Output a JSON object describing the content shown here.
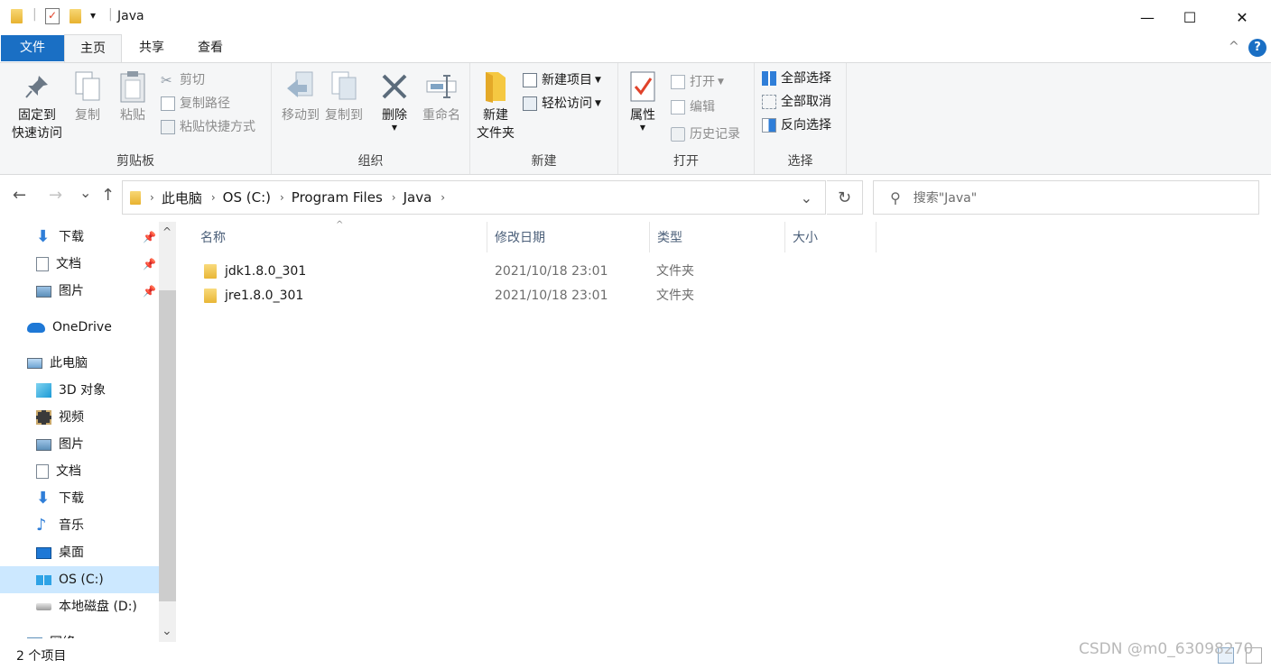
{
  "window": {
    "title": "Java",
    "minimize_glyph": "—",
    "maximize_glyph": "☐",
    "close_glyph": "✕"
  },
  "quick_access": {
    "dropdown_glyph": "▾"
  },
  "tabs": [
    {
      "label": "文件"
    },
    {
      "label": "主页"
    },
    {
      "label": "共享"
    },
    {
      "label": "查看"
    }
  ],
  "ribbon": {
    "collapse_glyph": "^",
    "help_glyph": "?",
    "clipboard": {
      "label": "剪贴板",
      "pin_line1": "固定到",
      "pin_line2": "快速访问",
      "copy": "复制",
      "paste": "粘贴",
      "cut": "剪切",
      "copy_path": "复制路径",
      "paste_shortcut": "粘贴快捷方式"
    },
    "organize": {
      "label": "组织",
      "move_to": "移动到",
      "copy_to": "复制到",
      "delete": "删除",
      "rename": "重命名"
    },
    "new": {
      "label": "新建",
      "new_folder_line1": "新建",
      "new_folder_line2": "文件夹",
      "new_item": "新建项目",
      "easy_access": "轻松访问"
    },
    "open": {
      "label": "打开",
      "properties": "属性",
      "open": "打开",
      "edit": "编辑",
      "history": "历史记录"
    },
    "select": {
      "label": "选择",
      "select_all": "全部选择",
      "select_none": "全部取消",
      "invert": "反向选择"
    }
  },
  "navigation": {
    "back_glyph": "←",
    "forward_glyph": "→",
    "recent_glyph": "⌄",
    "up_glyph": "↑",
    "breadcrumb": [
      "此电脑",
      "OS (C:)",
      "Program Files",
      "Java"
    ],
    "crumb_sep": "›",
    "addr_dropdown_glyph": "⌄",
    "refresh_glyph": "↻",
    "search_placeholder": "搜索\"Java\"",
    "search_glyph": "⚲"
  },
  "nav_pane": {
    "pin_glyph": "📌",
    "scroll_up_glyph": "^",
    "scroll_down_glyph": "⌄",
    "quick": [
      {
        "label": "下载"
      },
      {
        "label": "文档"
      },
      {
        "label": "图片"
      }
    ],
    "onedrive": "OneDrive",
    "this_pc": "此电脑",
    "pc_items": [
      {
        "label": "3D 对象"
      },
      {
        "label": "视频"
      },
      {
        "label": "图片"
      },
      {
        "label": "文档"
      },
      {
        "label": "下载"
      },
      {
        "label": "音乐"
      },
      {
        "label": "桌面"
      },
      {
        "label": "OS (C:)"
      },
      {
        "label": "本地磁盘 (D:)"
      }
    ],
    "network_partial": "网络"
  },
  "file_list": {
    "sort_glyph": "^",
    "columns": {
      "name": "名称",
      "date": "修改日期",
      "type": "类型",
      "size": "大小"
    },
    "rows": [
      {
        "name": "jdk1.8.0_301",
        "date": "2021/10/18 23:01",
        "type": "文件夹"
      },
      {
        "name": "jre1.8.0_301",
        "date": "2021/10/18 23:01",
        "type": "文件夹"
      }
    ]
  },
  "status": {
    "item_count": "2 个项目",
    "watermark": "CSDN @m0_63098270"
  },
  "colors": {
    "accent": "#1a6fc4",
    "folder": "#e9b636",
    "selected_nav": "#cce8ff"
  }
}
